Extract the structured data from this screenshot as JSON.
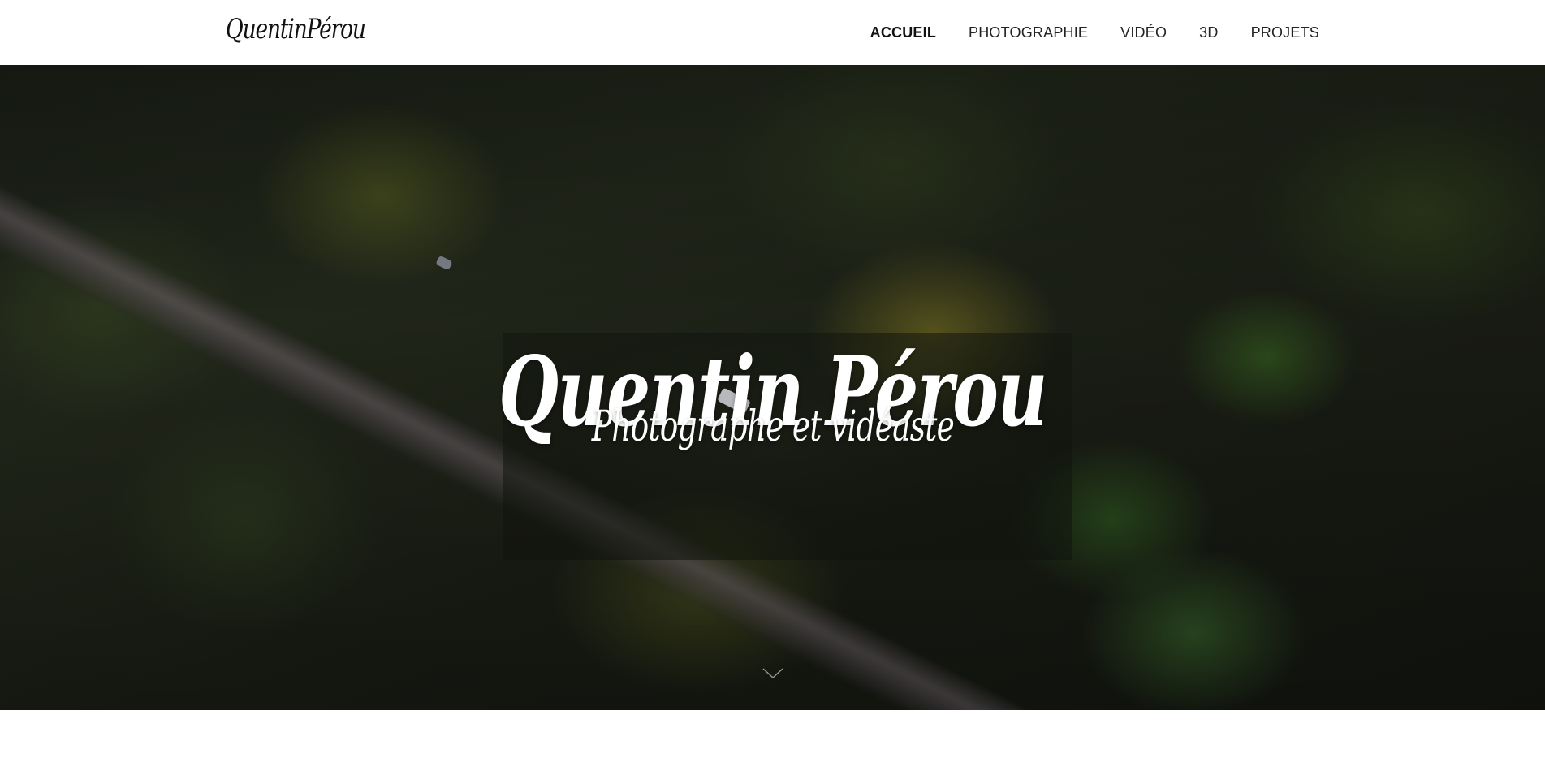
{
  "header": {
    "brand": "QuentinPérou",
    "nav": [
      {
        "label": "ACCUEIL",
        "active": true
      },
      {
        "label": "PHOTOGRAPHIE",
        "active": false
      },
      {
        "label": "VIDÉO",
        "active": false
      },
      {
        "label": "3D",
        "active": false
      },
      {
        "label": "PROJETS",
        "active": false
      }
    ]
  },
  "hero": {
    "title": "Quentin Pérou",
    "subtitle": "Photographe et vidéaste",
    "scroll_icon": "chevron-down-icon",
    "background_description_colors": {
      "foliage": "#2a3120",
      "road": "#6e6669"
    }
  }
}
